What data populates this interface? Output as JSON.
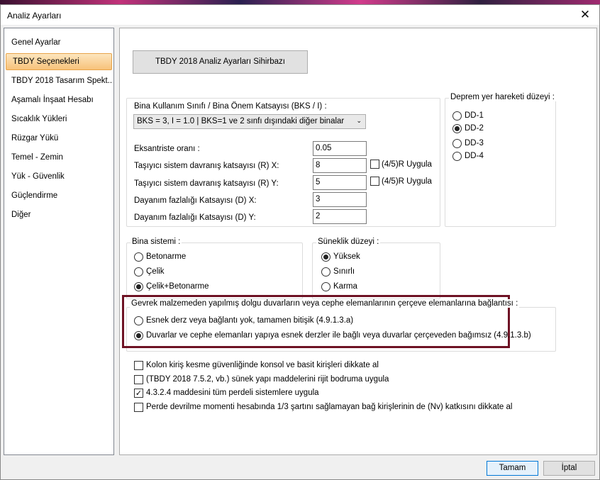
{
  "window": {
    "title": "Analiz Ayarları",
    "close_icon": "✕"
  },
  "sidebar": {
    "items": [
      "Genel Ayarlar",
      "TBDY Seçenekleri",
      "TBDY 2018 Tasarım Spekt...",
      "Aşamalı İnşaat Hesabı",
      "Sıcaklık Yükleri",
      "Rüzgar Yükü",
      "Temel - Zemin",
      "Yük - Güvenlik",
      "Güçlendirme",
      "Diğer"
    ],
    "selected_index": 1
  },
  "wizard_button": "TBDY 2018 Analiz Ayarları Sihirbazı",
  "building": {
    "label": "Bina Kullanım Sınıfı / Bina Önem Katsayısı (BKS / I) :",
    "select_value": "BKS = 3, I = 1.0 | BKS=1 ve 2 sınfı dışındaki diğer binalar",
    "fields": [
      {
        "label": "Eksantriste oranı :",
        "value": "0.05"
      },
      {
        "label": "Taşıyıcı sistem davranış katsayısı (R) X:",
        "value": "8",
        "check_label": "(4/5)R Uygula",
        "checked": false
      },
      {
        "label": "Taşıyıcı sistem davranış katsayısı (R) Y:",
        "value": "5",
        "check_label": "(4/5)R Uygula",
        "checked": false
      },
      {
        "label": "Dayanım fazlalığı Katsayısı (D) X:",
        "value": "3"
      },
      {
        "label": "Dayanım fazlalığı Katsayısı (D) Y:",
        "value": "2"
      }
    ]
  },
  "earthquake": {
    "title": "Deprem yer hareketi düzeyi :",
    "options": [
      "DD-1",
      "DD-2",
      "DD-3",
      "DD-4"
    ],
    "selected": 1
  },
  "system": {
    "title": "Bina sistemi :",
    "options": [
      "Betonarme",
      "Çelik",
      "Çelik+Betonarme"
    ],
    "selected": 2
  },
  "ductility": {
    "title": "Süneklik düzeyi :",
    "options": [
      "Yüksek",
      "Sınırlı",
      "Karma"
    ],
    "selected": 0
  },
  "infill": {
    "title": "Gevrek malzemeden yapılmış dolgu duvarların veya cephe elemanlarının çerçeve elemanlarına bağlantısı :",
    "options": [
      "Esnek derz veya bağlantı yok, tamamen bitişik (4.9.1.3.a)",
      "Duvarlar ve cephe elemanları yapıya esnek derzler ile bağlı veya duvarlar çerçeveden bağımsız (4.9.1.3.b)"
    ],
    "selected": 1
  },
  "checks": [
    {
      "label": "Kolon kiriş kesme güvenliğinde konsol ve basit kirişleri dikkate al",
      "checked": false
    },
    {
      "label": "(TBDY 2018 7.5.2, vb.) sünek yapı maddelerini rijit bodruma uygula",
      "checked": false
    },
    {
      "label": "4.3.2.4 maddesini tüm perdeli sistemlere uygula",
      "checked": true
    },
    {
      "label": "Perde devrilme momenti hesabında 1/3 şartını sağlamayan bağ kirişlerinin de (Nv) katkısını dikkate al",
      "checked": false
    }
  ],
  "footer": {
    "ok": "Tamam",
    "cancel": "İptal"
  },
  "icons": {
    "checkmark": "✓",
    "chevron": "⌄"
  },
  "colors": {
    "highlight_border": "#6e1224",
    "selected_nav": "#f7c27a"
  }
}
